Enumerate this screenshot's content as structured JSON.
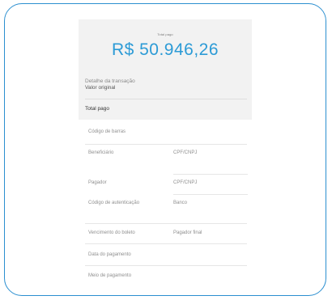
{
  "receipt": {
    "total_label": "Total pago",
    "amount": "R$ 50.946,26",
    "detail_label": "Detalhe da transação",
    "original_value_label": "Valor original",
    "total_paid_label": "Total pago",
    "fields": {
      "bank_code": "Código de barras",
      "beneficiary": "Beneficiário",
      "beneficiary_doc": "CPF/CNPJ",
      "payer": "Pagador",
      "payer_doc": "CPF/CNPJ",
      "auth_code": "Código de autenticação",
      "bank": "Banco",
      "due_date": "Vencimento do boleto",
      "final_payer": "Pagador final",
      "payment_date": "Data do pagamento",
      "payment_method": "Meio de pagamento"
    }
  },
  "colors": {
    "frame_border": "#2b8fd0",
    "amount": "#2c9bd6",
    "header_bg": "#f2f2f2"
  }
}
